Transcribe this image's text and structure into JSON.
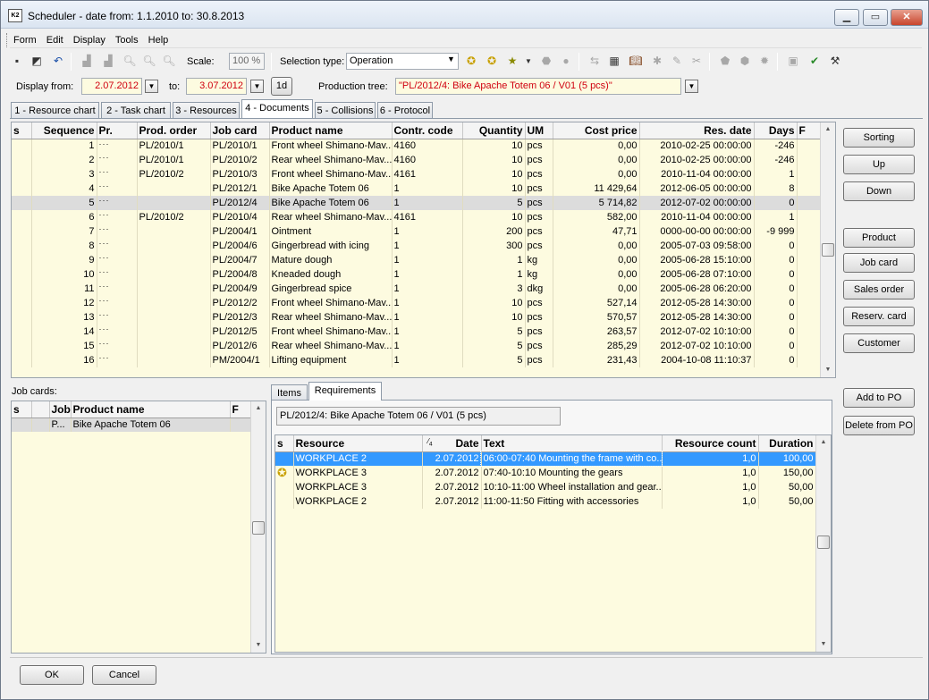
{
  "window": {
    "title": "Scheduler - date from: 1.1.2010 to: 30.8.2013",
    "icon_text": "K2"
  },
  "menu": [
    "Form",
    "Edit",
    "Display",
    "Tools",
    "Help"
  ],
  "toolbar": {
    "scale_label": "Scale:",
    "scale_value": "100 %",
    "selection_label": "Selection type:",
    "selection_value": "Operation"
  },
  "filter": {
    "display_from_label": "Display from:",
    "from_value": "2.07.2012",
    "to_label": "to:",
    "to_value": "3.07.2012",
    "day_button": "1d",
    "production_tree_label": "Production tree:",
    "production_tree_value": "\"PL/2012/4: Bike Apache Totem 06 / V01 (5 pcs)\""
  },
  "tabs": [
    "1 - Resource chart",
    "2 - Task chart",
    "3 - Resources",
    "4 - Documents",
    "5 - Collisions",
    "6 - Protocol"
  ],
  "active_tab": "4 - Documents",
  "documents": {
    "columns": [
      "s",
      "Sequence",
      "Pr.",
      "Prod. order",
      "Job card",
      "Product name",
      "Contr. code",
      "Quantity",
      "UM",
      "Cost price",
      "Res. date",
      "Days",
      "F"
    ],
    "rows": [
      {
        "seq": "1",
        "pr": "···",
        "order": "PL/2010/1",
        "job": "PL/2010/1",
        "name": "Front wheel Shimano-Mav...",
        "code": "4160",
        "qty": "10",
        "um": "pcs",
        "cost": "0,00",
        "date": "2010-02-25 00:00:00",
        "days": "-246"
      },
      {
        "seq": "2",
        "pr": "···",
        "order": "PL/2010/1",
        "job": "PL/2010/2",
        "name": "Rear wheel Shimano-Mav...",
        "code": "4160",
        "qty": "10",
        "um": "pcs",
        "cost": "0,00",
        "date": "2010-02-25 00:00:00",
        "days": "-246"
      },
      {
        "seq": "3",
        "pr": "···",
        "order": "PL/2010/2",
        "job": "PL/2010/3",
        "name": "Front wheel Shimano-Mav...",
        "code": "4161",
        "qty": "10",
        "um": "pcs",
        "cost": "0,00",
        "date": "2010-11-04 00:00:00",
        "days": "1"
      },
      {
        "seq": "4",
        "pr": "···",
        "order": "",
        "job": "PL/2012/1",
        "name": "Bike Apache Totem 06",
        "code": "1",
        "qty": "10",
        "um": "pcs",
        "cost": "11 429,64",
        "date": "2012-06-05 00:00:00",
        "days": "8"
      },
      {
        "seq": "5",
        "pr": "···",
        "order": "",
        "job": "PL/2012/4",
        "name": "Bike Apache Totem 06",
        "code": "1",
        "qty": "5",
        "um": "pcs",
        "cost": "5 714,82",
        "date": "2012-07-02 00:00:00",
        "days": "0"
      },
      {
        "seq": "6",
        "pr": "···",
        "order": "PL/2010/2",
        "job": "PL/2010/4",
        "name": "Rear wheel Shimano-Mav...",
        "code": "4161",
        "qty": "10",
        "um": "pcs",
        "cost": "582,00",
        "date": "2010-11-04 00:00:00",
        "days": "1"
      },
      {
        "seq": "7",
        "pr": "···",
        "order": "",
        "job": "PL/2004/1",
        "name": "Ointment",
        "code": "1",
        "qty": "200",
        "um": "pcs",
        "cost": "47,71",
        "date": "0000-00-00 00:00:00",
        "days": "-9 999"
      },
      {
        "seq": "8",
        "pr": "···",
        "order": "",
        "job": "PL/2004/6",
        "name": "Gingerbread with icing",
        "code": "1",
        "qty": "300",
        "um": "pcs",
        "cost": "0,00",
        "date": "2005-07-03 09:58:00",
        "days": "0"
      },
      {
        "seq": "9",
        "pr": "···",
        "order": "",
        "job": "PL/2004/7",
        "name": "Mature dough",
        "code": "1",
        "qty": "1",
        "um": "kg",
        "cost": "0,00",
        "date": "2005-06-28 15:10:00",
        "days": "0"
      },
      {
        "seq": "10",
        "pr": "···",
        "order": "",
        "job": "PL/2004/8",
        "name": "Kneaded dough",
        "code": "1",
        "qty": "1",
        "um": "kg",
        "cost": "0,00",
        "date": "2005-06-28 07:10:00",
        "days": "0"
      },
      {
        "seq": "11",
        "pr": "···",
        "order": "",
        "job": "PL/2004/9",
        "name": "Gingerbread spice",
        "code": "1",
        "qty": "3",
        "um": "dkg",
        "cost": "0,00",
        "date": "2005-06-28 06:20:00",
        "days": "0"
      },
      {
        "seq": "12",
        "pr": "···",
        "order": "",
        "job": "PL/2012/2",
        "name": "Front wheel Shimano-Mav...",
        "code": "1",
        "qty": "10",
        "um": "pcs",
        "cost": "527,14",
        "date": "2012-05-28 14:30:00",
        "days": "0"
      },
      {
        "seq": "13",
        "pr": "···",
        "order": "",
        "job": "PL/2012/3",
        "name": "Rear wheel Shimano-Mav...",
        "code": "1",
        "qty": "10",
        "um": "pcs",
        "cost": "570,57",
        "date": "2012-05-28 14:30:00",
        "days": "0"
      },
      {
        "seq": "14",
        "pr": "···",
        "order": "",
        "job": "PL/2012/5",
        "name": "Front wheel Shimano-Mav...",
        "code": "1",
        "qty": "5",
        "um": "pcs",
        "cost": "263,57",
        "date": "2012-07-02 10:10:00",
        "days": "0"
      },
      {
        "seq": "15",
        "pr": "···",
        "order": "",
        "job": "PL/2012/6",
        "name": "Rear wheel Shimano-Mav...",
        "code": "1",
        "qty": "5",
        "um": "pcs",
        "cost": "285,29",
        "date": "2012-07-02 10:10:00",
        "days": "0"
      },
      {
        "seq": "16",
        "pr": "···",
        "order": "",
        "job": "PM/2004/1",
        "name": "Lifting equipment",
        "code": "1",
        "qty": "5",
        "um": "pcs",
        "cost": "231,43",
        "date": "2004-10-08 11:10:37",
        "days": "0"
      }
    ]
  },
  "side_buttons": [
    "Sorting",
    "Up",
    "Down",
    "Product",
    "Job card",
    "Sales order",
    "Reserv. card",
    "Customer"
  ],
  "job_cards": {
    "label": "Job cards:",
    "columns": [
      "s",
      "Job",
      "Product name",
      "F"
    ],
    "rows": [
      {
        "job": "P...",
        "name": "Bike Apache Totem 06"
      }
    ]
  },
  "sub_tabs": [
    "Items",
    "Requirements"
  ],
  "requirements": {
    "header_value": "PL/2012/4: Bike Apache Totem 06 / V01 (5 pcs)",
    "sort_marker": "4",
    "columns": [
      "s",
      "Resource",
      "Date",
      "Text",
      "Resource count",
      "Duration"
    ],
    "rows": [
      {
        "resource": "WORKPLACE 2",
        "date": "2.07.2012",
        "text": "06:00-07:40 Mounting the frame with co...",
        "count": "1,0",
        "duration": "100,00"
      },
      {
        "resource": "WORKPLACE 3",
        "date": "2.07.2012",
        "text": "07:40-10:10 Mounting the gears",
        "count": "1,0",
        "duration": "150,00"
      },
      {
        "resource": "WORKPLACE 3",
        "date": "2.07.2012",
        "text": "10:10-11:00 Wheel installation and gear...",
        "count": "1,0",
        "duration": "50,00"
      },
      {
        "resource": "WORKPLACE 2",
        "date": "2.07.2012",
        "text": "11:00-11:50 Fitting with accessories",
        "count": "1,0",
        "duration": "50,00"
      }
    ]
  },
  "po_buttons": [
    "Add to PO",
    "Delete from PO"
  ],
  "footer": {
    "ok": "OK",
    "cancel": "Cancel"
  },
  "colors": {
    "grid_bg": "#fdfbe0",
    "selection": "#3399ff",
    "date_red": "#d0000f"
  }
}
